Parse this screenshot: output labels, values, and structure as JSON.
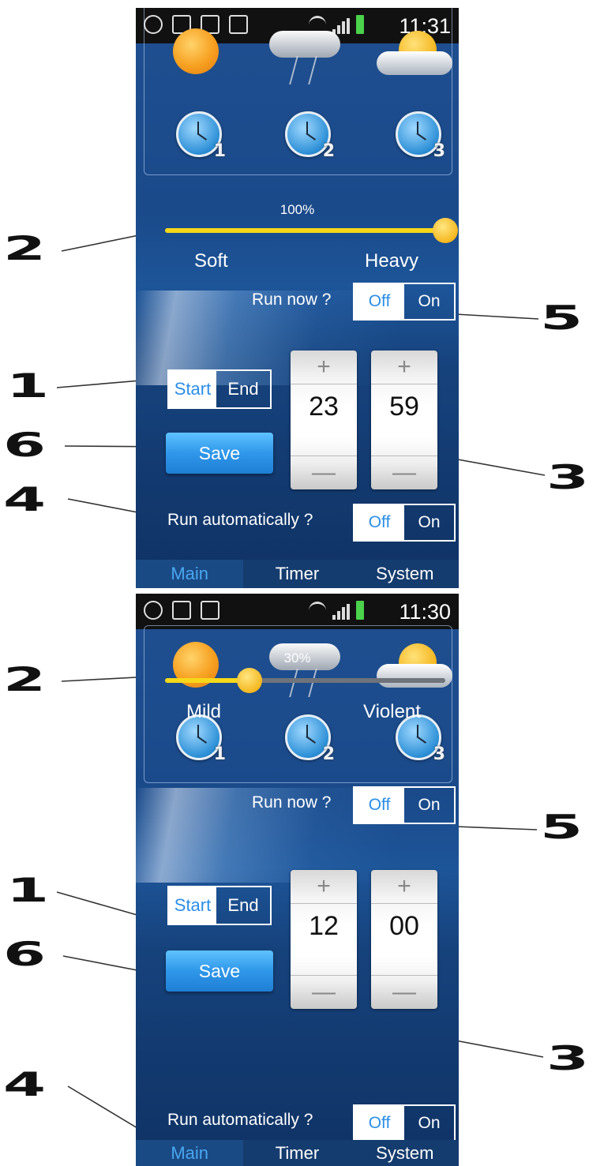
{
  "callouts": {
    "one": "1",
    "two": "2",
    "three": "3",
    "four": "4",
    "five": "5",
    "six": "6"
  },
  "screens": [
    {
      "status_time": "11:31",
      "weather_icons": [
        "sun-icon",
        "thunderstorm-icon",
        "partly-cloudy-icon"
      ],
      "timer_icons": [
        {
          "icon": "clock-icon",
          "number": "1"
        },
        {
          "icon": "clock-icon",
          "number": "2"
        },
        {
          "icon": "clock-icon",
          "number": "3"
        }
      ],
      "intensity_percent": "100%",
      "intensity_value": 1.0,
      "intensity_min_label": "Soft",
      "intensity_max_label": "Heavy",
      "run_now_label": "Run now ?",
      "run_now_off": "Off",
      "run_now_on": "On",
      "start_label": "Start",
      "end_label": "End",
      "save_label": "Save",
      "hours": "23",
      "minutes": "59",
      "plus_symbol": "+",
      "minus_symbol": "—",
      "run_auto_label": "Run automatically ?",
      "run_auto_off": "Off",
      "run_auto_on": "On",
      "tabs": [
        "Main",
        "Timer",
        "System"
      ]
    },
    {
      "status_time": "11:30",
      "weather_icons": [
        "sun-icon",
        "thunderstorm-icon",
        "partly-cloudy-icon"
      ],
      "timer_icons": [
        {
          "icon": "clock-icon",
          "number": "1"
        },
        {
          "icon": "clock-icon",
          "number": "2"
        },
        {
          "icon": "clock-icon",
          "number": "3"
        }
      ],
      "intensity_percent": "30%",
      "intensity_value": 0.3,
      "intensity_min_label": "Mild",
      "intensity_max_label": "Violent",
      "run_now_label": "Run now ?",
      "run_now_off": "Off",
      "run_now_on": "On",
      "start_label": "Start",
      "end_label": "End",
      "save_label": "Save",
      "hours": "12",
      "minutes": "00",
      "plus_symbol": "+",
      "minus_symbol": "—",
      "run_auto_label": "Run automatically ?",
      "run_auto_off": "Off",
      "run_auto_on": "On",
      "tabs": [
        "Main",
        "Timer",
        "System"
      ]
    }
  ],
  "colors": {
    "accent": "#2b8fe6",
    "slider_fill": "#f7d81a",
    "background": "#1a4a8a"
  }
}
